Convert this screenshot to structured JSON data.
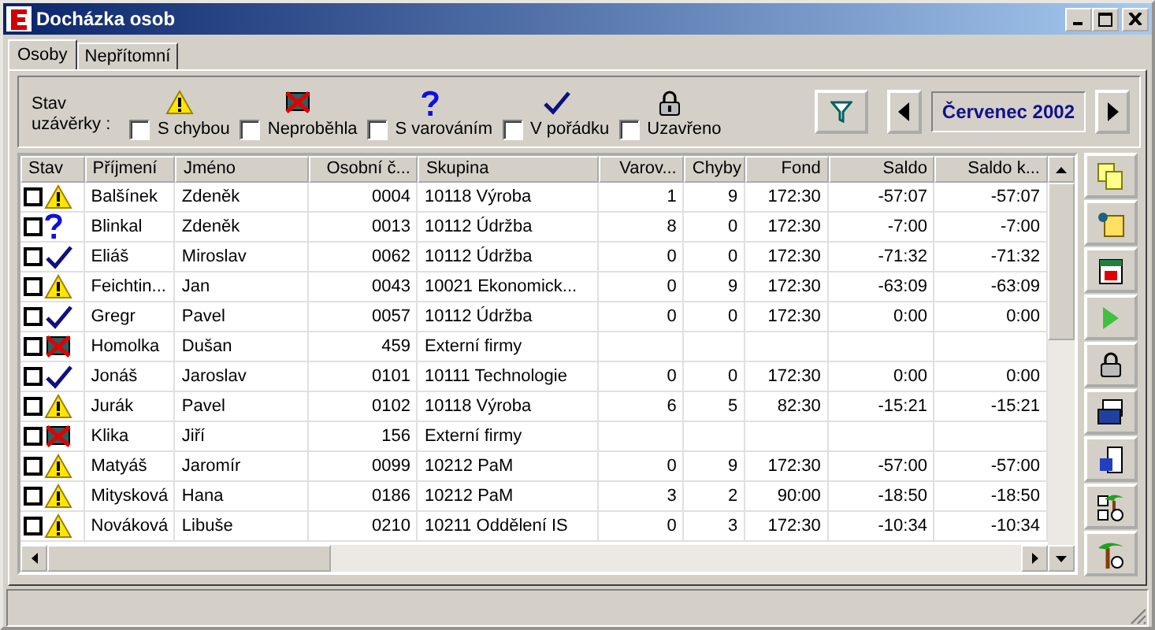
{
  "window": {
    "title": "Docházka osob"
  },
  "tabs": [
    {
      "label": "Osoby",
      "selected": true
    },
    {
      "label": "Nepřítomní",
      "selected": false
    }
  ],
  "filter": {
    "label": "Stav uzávěrky :",
    "options": [
      {
        "kind": "warning",
        "label": "S chybou",
        "checked": false
      },
      {
        "kind": "notrun",
        "label": "Neproběhla",
        "checked": false
      },
      {
        "kind": "question",
        "label": "S varováním",
        "checked": false
      },
      {
        "kind": "ok",
        "label": "V pořádku",
        "checked": false
      },
      {
        "kind": "lock",
        "label": "Uzavřeno",
        "checked": false
      }
    ],
    "month": "Červenec 2002"
  },
  "table": {
    "columns": [
      "Stav",
      "Příjmení",
      "Jméno",
      "Osobní č...",
      "Skupina",
      "Varov...",
      "Chyby",
      "Fond",
      "Saldo",
      "Saldo k..."
    ],
    "rows": [
      {
        "checked": false,
        "kind": "warning",
        "cells": [
          "",
          "Balšínek",
          "Zdeněk",
          "0004",
          "10118 Výroba",
          "1",
          "9",
          "172:30",
          "-57:07",
          "-57:07"
        ]
      },
      {
        "checked": false,
        "kind": "question",
        "cells": [
          "",
          "Blinkal",
          "Zdeněk",
          "0013",
          "10112 Údržba",
          "8",
          "0",
          "172:30",
          "-7:00",
          "-7:00"
        ]
      },
      {
        "checked": false,
        "kind": "ok",
        "cells": [
          "",
          "Eliáš",
          "Miroslav",
          "0062",
          "10112 Údržba",
          "0",
          "0",
          "172:30",
          "-71:32",
          "-71:32"
        ]
      },
      {
        "checked": false,
        "kind": "warning",
        "cells": [
          "",
          "Feichtin...",
          "Jan",
          "0043",
          "10021 Ekonomick...",
          "0",
          "9",
          "172:30",
          "-63:09",
          "-63:09"
        ]
      },
      {
        "checked": false,
        "kind": "ok",
        "cells": [
          "",
          "Gregr",
          "Pavel",
          "0057",
          "10112 Údržba",
          "0",
          "0",
          "172:30",
          "0:00",
          "0:00"
        ]
      },
      {
        "checked": false,
        "kind": "notrun",
        "cells": [
          "",
          "Homolka",
          "Dušan",
          "459",
          "Externí firmy",
          "",
          "",
          "",
          "",
          ""
        ]
      },
      {
        "checked": false,
        "kind": "ok",
        "cells": [
          "",
          "Jonáš",
          "Jaroslav",
          "0101",
          "10111 Technologie",
          "0",
          "0",
          "172:30",
          "0:00",
          "0:00"
        ]
      },
      {
        "checked": false,
        "kind": "warning",
        "cells": [
          "",
          "Jurák",
          "Pavel",
          "0102",
          "10118 Výroba",
          "6",
          "5",
          "82:30",
          "-15:21",
          "-15:21"
        ]
      },
      {
        "checked": false,
        "kind": "notrun",
        "cells": [
          "",
          "Klika",
          "Jiří",
          "156",
          "Externí firmy",
          "",
          "",
          "",
          "",
          ""
        ]
      },
      {
        "checked": false,
        "kind": "warning",
        "cells": [
          "",
          "Matyáš",
          "Jaromír",
          "0099",
          "10212 PaM",
          "0",
          "9",
          "172:30",
          "-57:00",
          "-57:00"
        ]
      },
      {
        "checked": false,
        "kind": "warning",
        "cells": [
          "",
          "Mitysková",
          "Hana",
          "0186",
          "10212 PaM",
          "3",
          "2",
          "90:00",
          "-18:50",
          "-18:50"
        ]
      },
      {
        "checked": false,
        "kind": "warning",
        "cells": [
          "",
          "Nováková",
          "Libuše",
          "0210",
          "10211 Oddělení IS",
          "0",
          "3",
          "172:30",
          "-10:34",
          "-10:34"
        ]
      }
    ]
  },
  "toolbar": [
    {
      "kind": "copy"
    },
    {
      "kind": "note"
    },
    {
      "kind": "calendar"
    },
    {
      "kind": "play"
    },
    {
      "kind": "lock"
    },
    {
      "kind": "print"
    },
    {
      "kind": "export"
    },
    {
      "kind": "palm-check"
    },
    {
      "kind": "palm-clock"
    }
  ]
}
